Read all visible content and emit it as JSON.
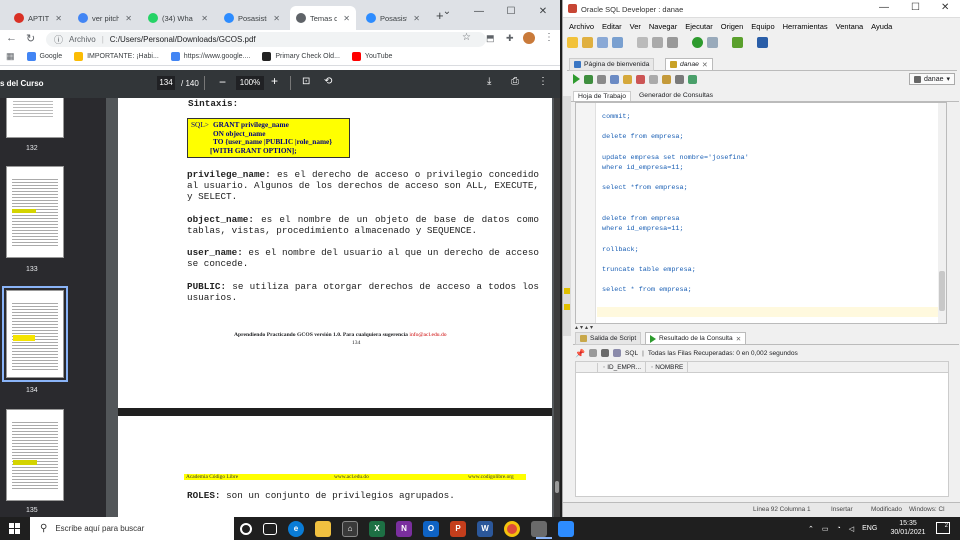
{
  "browser": {
    "tabs": [
      {
        "label": "APTITUD",
        "color": "#d93025",
        "active": false
      },
      {
        "label": "ver pitch",
        "color": "#4285f4",
        "active": false
      },
      {
        "label": "(34) Wha",
        "color": "#25d366",
        "active": false
      },
      {
        "label": "Posasisti",
        "color": "#2d8cff",
        "active": false
      },
      {
        "label": "Temas de",
        "color": "#5f6368",
        "active": true
      },
      {
        "label": "Posasista",
        "color": "#2d8cff",
        "active": false
      }
    ],
    "new_tab": "+",
    "address_prefix": "Archivo",
    "address": "C:/Users/Personal/Downloads/GCOS.pdf",
    "bookmarks": [
      {
        "label": "Google",
        "color": "#4285f4"
      },
      {
        "label": "IMPORTANTE: ¡Habi...",
        "color": "#fbbc04"
      },
      {
        "label": "https://www.google....",
        "color": "#4285f4"
      },
      {
        "label": "Primary Check Old...",
        "color": "#222222"
      },
      {
        "label": "YouTube",
        "color": "#ff0000"
      }
    ]
  },
  "pdf": {
    "doc_title": "s del Curso",
    "page_current": "134",
    "page_total": "/ 140",
    "zoom": "100%",
    "thumb_labels": [
      "132",
      "133",
      "134",
      "135"
    ],
    "section_heading": "Sintaxis:",
    "syntax_box": {
      "prefix": "SQL>",
      "lines": [
        "GRANT privilege_name",
        "ON object_name",
        "TO {user_name |PUBLIC |role_name}",
        "[WITH GRANT OPTION];"
      ]
    },
    "paragraphs": [
      {
        "term": "privilege_name:",
        "text": " es el derecho de acceso o privilegio concedido al usuario. Algunos de los derechos de acceso son ALL, EXECUTE, y SELECT."
      },
      {
        "term": "object_name:",
        "text": " es el nombre de un objeto de base de datos como tablas, vistas, procedimiento almacenado y SEQUENCE."
      },
      {
        "term": "user_name:",
        "text": " es el nombre del usuario al que un derecho de acceso se concede."
      },
      {
        "term": "PUBLIC:",
        "text": " se utiliza para otorgar derechos de acceso a todos los usuarios."
      }
    ],
    "footer_text": "Aprendiendo Practicando GCOS versión 1.0. Para cualquiera sugerencia",
    "footer_email": "info@acl.edu.do",
    "footer_page": "134",
    "next_header_left": "Academia Código Libre",
    "next_header_center": "www.acl.edu.do",
    "next_header_right": "www.codigolibre.org",
    "next_paragraph": {
      "term": "ROLES:",
      "text": " son un conjunto de privilegios agrupados."
    }
  },
  "sqldev": {
    "title": "Oracle SQL Developer : danae",
    "menu": [
      "Archivo",
      "Editar",
      "Ver",
      "Navegar",
      "Ejecutar",
      "Origen",
      "Equipo",
      "Herramientas",
      "Ventana",
      "Ayuda"
    ],
    "doc_tabs": [
      "Página de bienvenida",
      "danae"
    ],
    "connection": "danae",
    "sub_tabs": [
      "Hoja de Trabajo",
      "Generador de Consultas"
    ],
    "code_lines": [
      {
        "text": "commit;",
        "row": 0
      },
      {
        "text": "delete from empresa;",
        "row": 2
      },
      {
        "text": "update empresa set nombre='josefina'",
        "row": 4
      },
      {
        "text": "where id_empresa=11;",
        "row": 5
      },
      {
        "text": "select *from empresa;",
        "row": 7
      },
      {
        "text": "delete from empresa",
        "row": 10
      },
      {
        "text": "where id_empresa=11;",
        "row": 11
      },
      {
        "text": "rollback;",
        "row": 13
      },
      {
        "text": "truncate table empresa;",
        "row": 15
      },
      {
        "text": "select * from empresa;",
        "row": 17
      }
    ],
    "output_tabs": [
      "Salida de Script",
      "Resultado de la Consulta"
    ],
    "result_status": "Todas las Filas Recuperadas: 0 en 0,002 segundos",
    "sql_label": "SQL",
    "columns": [
      "ID_EMPR...",
      "NOMBRE"
    ],
    "status_line": "Línea 92 Columna 1",
    "status_insert": "Insertar",
    "status_modified": "Modificado",
    "status_os": "Windows: Cl"
  },
  "taskbar": {
    "search_placeholder": "Escribe aquí para buscar",
    "lang": "ENG",
    "time": "15:35",
    "date": "30/01/2021",
    "notif": "2"
  }
}
